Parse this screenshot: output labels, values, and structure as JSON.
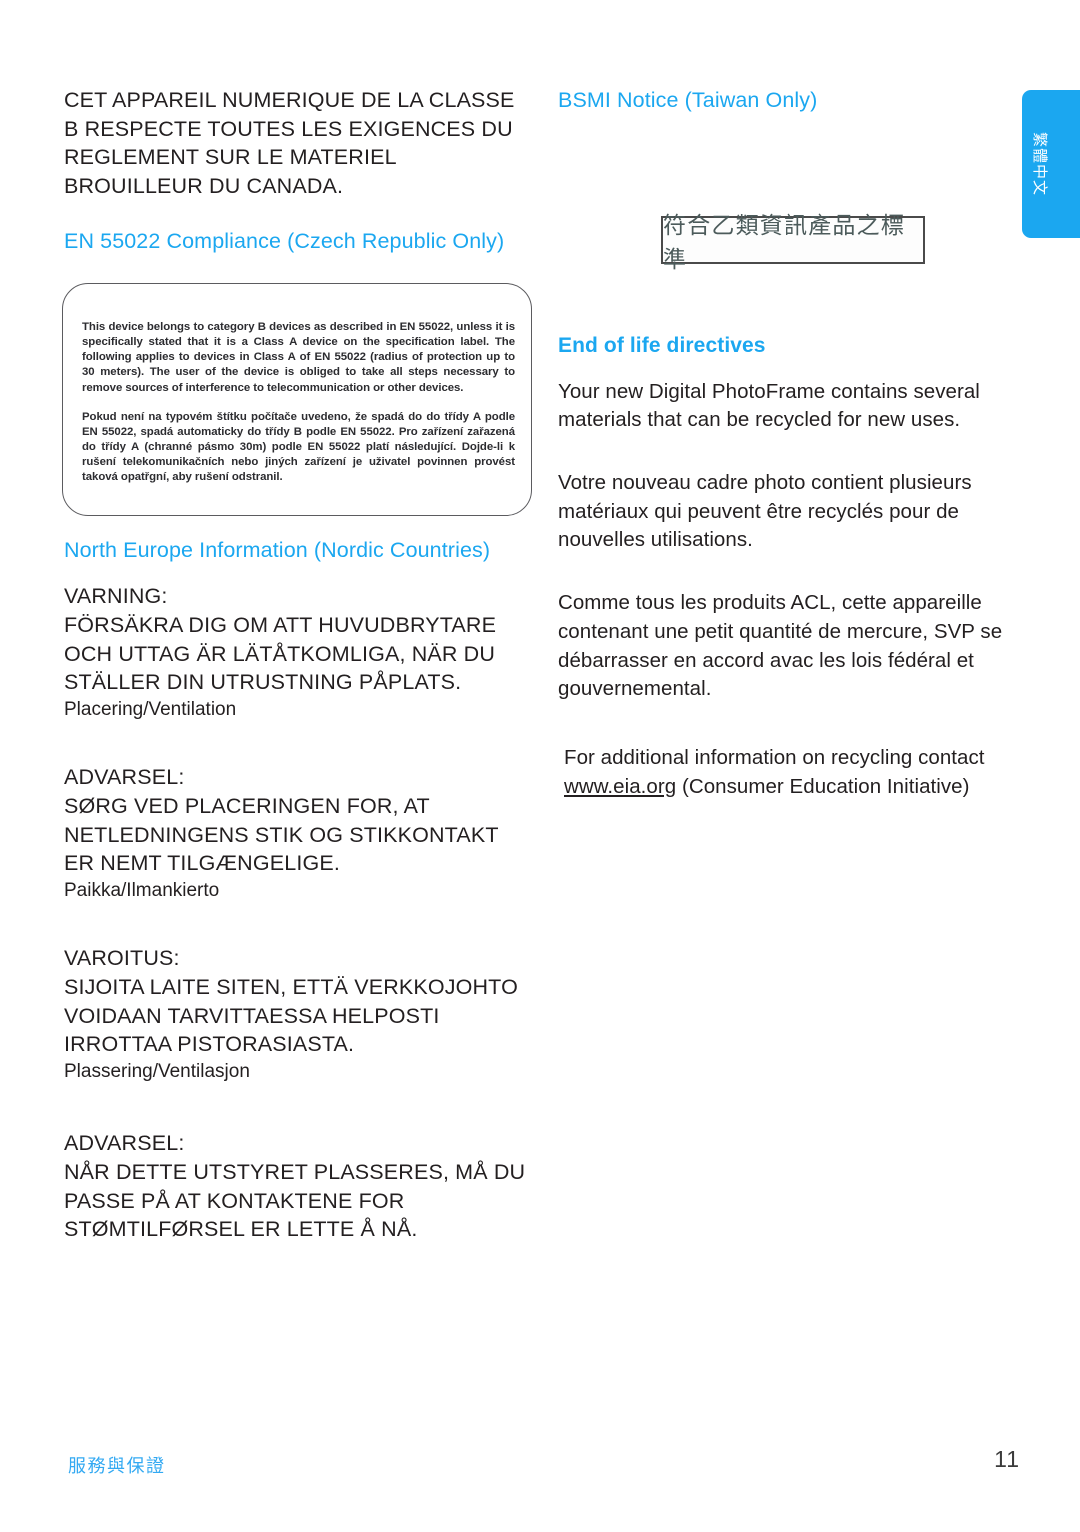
{
  "document": {
    "page_number": "11",
    "footer_label": "服務與保證",
    "language_tab": "繁體中文",
    "accent_color": "#1ba7f0",
    "text_color": "#231f20"
  },
  "left_column": {
    "canada_notice": "CET APPAREIL NUMERIQUE DE LA CLASSE B RESPECTE TOUTES LES EXIGENCES DU REGLEMENT SUR LE MATERIEL BROUILLEUR DU CANADA.",
    "czech_heading": "EN 55022 Compliance (Czech Republic Only)",
    "czech_box": {
      "english": "This device belongs to category B devices as described in EN 55022, unless it is specifically stated that it is a Class A device on the specification label. The following applies to devices in Class A of EN 55022 (radius of protection up to 30 meters). The user of the device is obliged to take all steps necessary to remove sources of interference to telecommunication or other devices.",
      "czech": "Pokud není na typovém štítku počítače uvedeno, že spadá do do třídy A podle EN 55022, spadá automaticky do třídy B podle EN 55022. Pro zařízení zařazená do třídy A (chranné pásmo 30m) podle EN 55022 platí následující. Dojde-li k rušení telekomunikačních nebo jiných zařízení je uživatel povinnen provést taková opatřgní, aby rušení odstranil."
    },
    "nordic_heading": "North Europe Information (Nordic Countries)",
    "nordic_blocks": [
      {
        "title": "VARNING:",
        "caps": "FÖRSÄKRA DIG OM ATT HUVUDBRYTARE OCH UTTAG ÄR LÄTÅTKOMLIGA, NÄR DU STÄLLER DIN UTRUSTNING PÅPLATS.",
        "sub": "Placering/Ventilation"
      },
      {
        "title": "ADVARSEL:",
        "caps": "SØRG VED PLACERINGEN FOR, AT NETLEDNINGENS STIK OG STIKKONTAKT ER NEMT TILGÆNGELIGE.",
        "sub": "Paikka/Ilmankierto"
      },
      {
        "title": "VAROITUS:",
        "caps": "SIJOITA LAITE SITEN, ETTÄ VERKKOJOHTO VOIDAAN TARVITTAESSA HELPOSTI IRROTTAA PISTORASIASTA.",
        "sub": "Plassering/Ventilasjon"
      },
      {
        "title": "ADVARSEL:",
        "caps": "NÅR DETTE UTSTYRET PLASSERES, MÅ DU PASSE PÅ AT KONTAKTENE FOR STØMTILFØRSEL ER LETTE Å NÅ.",
        "sub": ""
      }
    ]
  },
  "right_column": {
    "bsmi_heading": "BSMI Notice (Taiwan Only)",
    "bsmi_label": "符合乙類資訊產品之標準",
    "eol_heading": "End of life directives",
    "eol_paragraphs": [
      "Your new Digital PhotoFrame contains several materials that can be recycled for new uses.",
      "Votre nouveau cadre photo contient plusieurs matériaux qui peuvent être recyclés pour de nouvelles utilisations.",
      "Comme tous les produits ACL, cette appareille contenant une petit quantité de mercure, SVP se débarrasser en accord avac les lois fédéral et gouvernemental."
    ],
    "recycle_contact_prefix": "For additional information on recycling contact ",
    "recycle_contact_link": "www.eia.org",
    "recycle_contact_suffix": " (Consumer Education Initiative)"
  }
}
